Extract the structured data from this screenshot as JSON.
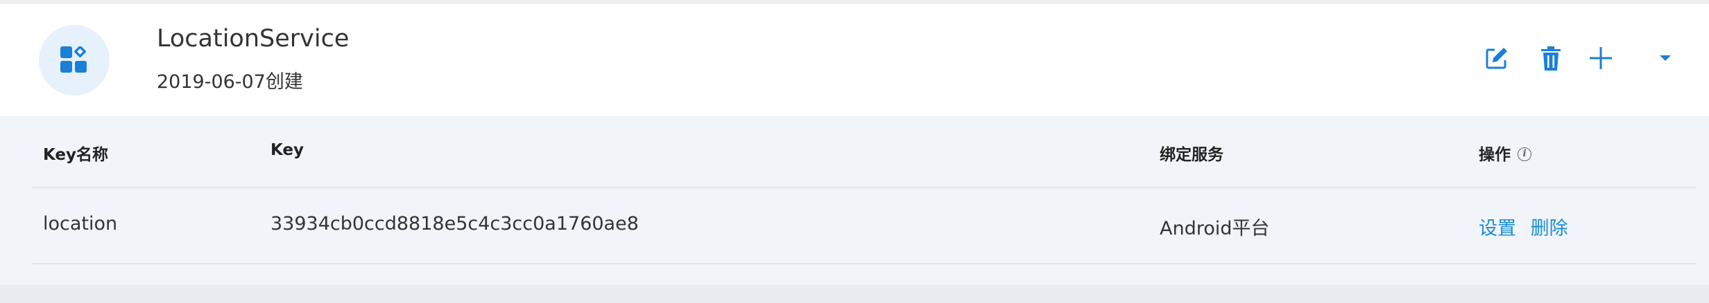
{
  "app": {
    "name": "LocationService",
    "created": "2019-06-07创建",
    "icon": "app-grid-icon"
  },
  "actions": {
    "edit_icon": "edit-icon",
    "delete_icon": "trash-icon",
    "add_icon": "plus-icon",
    "expand_icon": "caret-down-icon"
  },
  "table": {
    "headers": {
      "key_name": "Key名称",
      "key": "Key",
      "bound_service": "绑定服务",
      "operations": "操作",
      "operations_info": "i"
    },
    "rows": [
      {
        "key_name": "location",
        "key": "33934cb0ccd8818e5c4c3cc0a1760ae8",
        "bound_service": "Android平台",
        "settings_label": "设置",
        "delete_label": "删除"
      }
    ]
  },
  "colors": {
    "accent": "#1a8cd8",
    "icon_bg": "#e6f1fc"
  }
}
